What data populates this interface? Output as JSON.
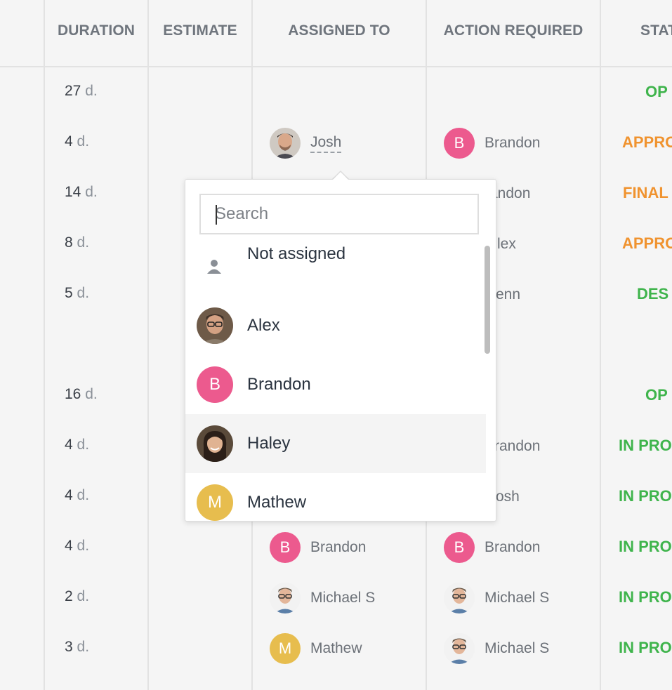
{
  "headers": {
    "col0": "",
    "duration": "DURATION",
    "estimate": "ESTIMATE",
    "assigned_to": "ASSIGNED TO",
    "action_required": "ACTION REQUIRED",
    "status": "STAT"
  },
  "rows": [
    {
      "duration": "27",
      "unit": "d.",
      "assigned": null,
      "action": null,
      "status": "OP",
      "status_color": "green"
    },
    {
      "duration": "4",
      "unit": "d.",
      "assigned": {
        "name": "Josh",
        "avatar": "photo-josh"
      },
      "action": {
        "name": "Brandon",
        "avatar": "B"
      },
      "status": "APPRO",
      "status_color": "orange"
    },
    {
      "duration": "14",
      "unit": "d.",
      "action_visible": "randon",
      "status": "FINAL",
      "status_color": "orange"
    },
    {
      "duration": "8",
      "unit": "d.",
      "action_visible": "lex",
      "status": "APPRO",
      "status_color": "orange"
    },
    {
      "duration": "5",
      "unit": "d.",
      "action_visible": "enn",
      "status": "DES",
      "status_color": "green"
    },
    {
      "duration": "16",
      "unit": "d.",
      "status": "OP",
      "status_color": "green"
    },
    {
      "duration": "4",
      "unit": "d.",
      "action_visible": "randon",
      "status": "IN PRO",
      "status_color": "green"
    },
    {
      "duration": "4",
      "unit": "d.",
      "action_visible": "osh",
      "status": "IN PRO",
      "status_color": "green"
    },
    {
      "duration": "4",
      "unit": "d.",
      "assigned": {
        "name": "Brandon",
        "avatar": "B"
      },
      "action": {
        "name": "Brandon",
        "avatar": "B"
      },
      "status": "IN PRO",
      "status_color": "green"
    },
    {
      "duration": "2",
      "unit": "d.",
      "assigned": {
        "name": "Michael S",
        "avatar": "photo-michael"
      },
      "action": {
        "name": "Michael S",
        "avatar": "photo-michael"
      },
      "status": "IN PRO",
      "status_color": "green"
    },
    {
      "duration": "3",
      "unit": "d.",
      "assigned": {
        "name": "Mathew",
        "avatar": "M"
      },
      "action": {
        "name": "Michael S",
        "avatar": "photo-michael"
      },
      "status": "IN PRO",
      "status_color": "green"
    }
  ],
  "dropdown": {
    "search_placeholder": "Search",
    "options": [
      {
        "label": "Not assigned",
        "icon": "person-icon"
      },
      {
        "label": "Alex",
        "avatar": "photo-alex"
      },
      {
        "label": "Brandon",
        "avatar": "B"
      },
      {
        "label": "Haley",
        "avatar": "photo-haley",
        "hovered": true
      },
      {
        "label": "Mathew",
        "avatar": "M"
      }
    ]
  },
  "colors": {
    "status_green": "#3fb44c",
    "status_orange": "#f0932f",
    "avatar_pink": "#ec5a8e",
    "avatar_yellow": "#e7bd4e"
  }
}
